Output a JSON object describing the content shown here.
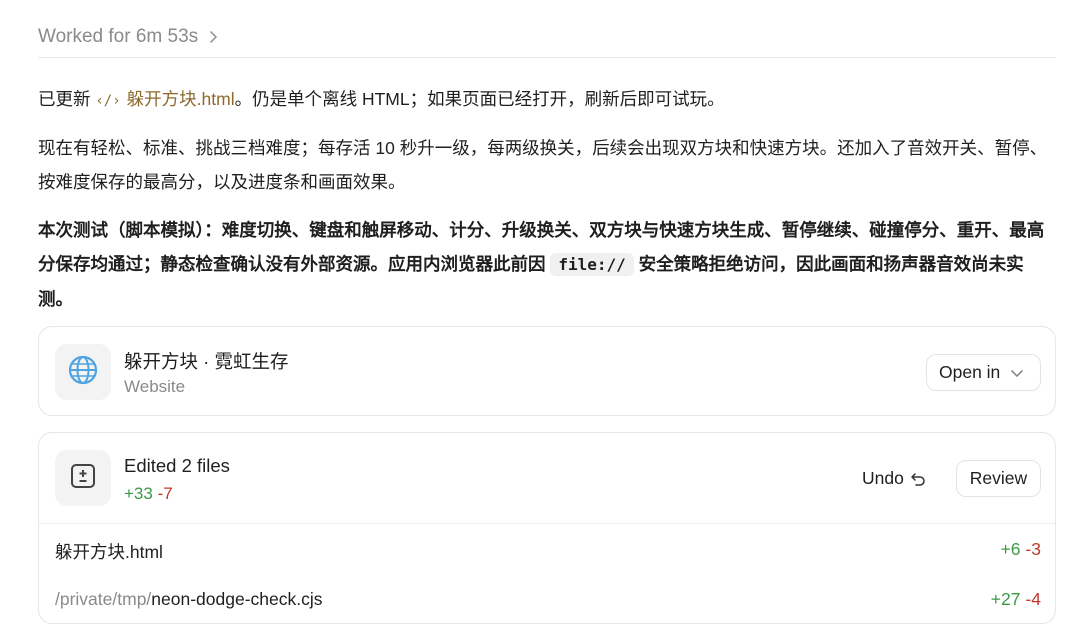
{
  "header": {
    "worked_label": "Worked for 6m 53s"
  },
  "message": {
    "p1_prefix": "已更新",
    "p1_file_icon": "‹/›",
    "p1_file": "躲开方块.html",
    "p1_suffix": "。仍是单个离线 HTML；如果页面已经打开，刷新后即可试玩。",
    "p2": "现在有轻松、标准、挑战三档难度；每存活 10 秒升一级，每两级换关，后续会出现双方块和快速方块。还加入了音效开关、暂停、按难度保存的最高分，以及进度条和画面效果。",
    "p3_prefix": "本次测试（脚本模拟）：难度切换、键盘和触屏移动、计分、升级换关、双方块与快速方块生成、暂停继续、碰撞停分、重开、最高分保存均通过；静态检查确认没有外部资源。应用内浏览器此前因 ",
    "p3_code": "file://",
    "p3_suffix": " 安全策略拒绝访问，因此画面和扬声器音效尚未实测。"
  },
  "website_card": {
    "icon": "globe-icon",
    "title": "躲开方块 · 霓虹生存",
    "subtitle": "Website",
    "open_in_label": "Open in"
  },
  "edits_card": {
    "icon": "diff-icon",
    "title": "Edited 2 files",
    "added": "+33",
    "removed": "-7",
    "undo_label": "Undo",
    "review_label": "Review",
    "files": [
      {
        "prefix": "",
        "name": "躲开方块.html",
        "added": "+6",
        "removed": "-3"
      },
      {
        "prefix": "/private/tmp/",
        "name": "neon-dodge-check.cjs",
        "added": "+27",
        "removed": "-4"
      }
    ]
  },
  "colors": {
    "added": "#3c9a47",
    "removed": "#c0392b",
    "file_link": "#8c6a2e",
    "globe": "#4fa3e0"
  }
}
